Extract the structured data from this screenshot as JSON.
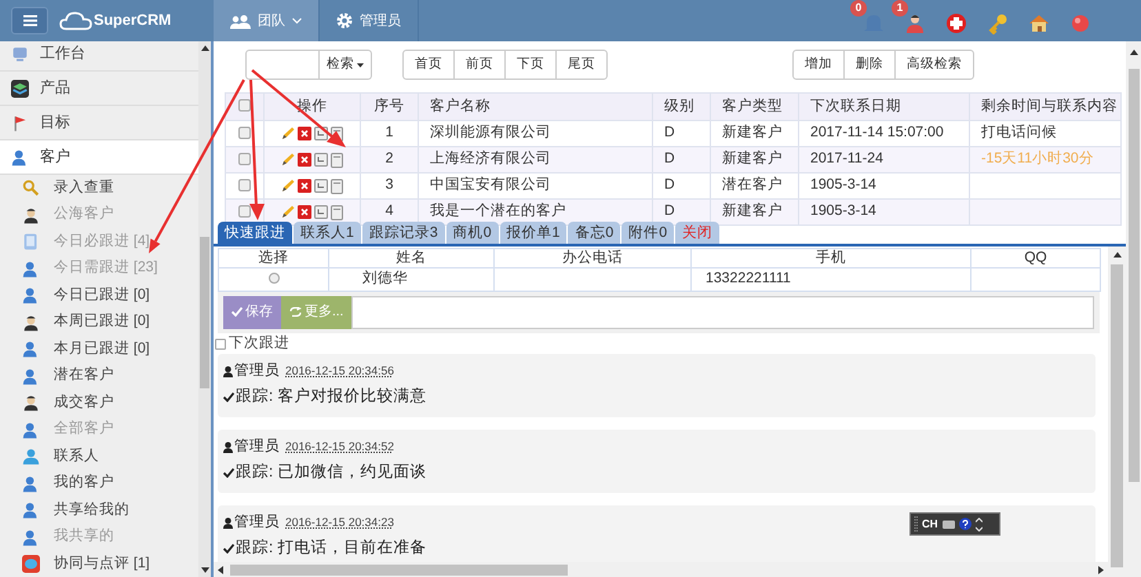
{
  "topbar": {
    "app_name": "SuperCRM",
    "nav": [
      {
        "label": "团队",
        "dropdown": true,
        "selected": true
      },
      {
        "label": "管理员",
        "dropdown": false,
        "selected": false
      }
    ],
    "icons": [
      {
        "kind": "bell",
        "badge": "0"
      },
      {
        "kind": "person",
        "badge": "1"
      },
      {
        "kind": "cross"
      },
      {
        "kind": "key"
      },
      {
        "kind": "house"
      },
      {
        "kind": "ball"
      }
    ]
  },
  "sidebar": {
    "items": [
      {
        "label": "工作台",
        "kind": "main",
        "selected": false
      },
      {
        "label": "产品",
        "kind": "main",
        "selected": false
      },
      {
        "label": "目标",
        "kind": "main",
        "selected": false
      },
      {
        "label": "客户",
        "kind": "main",
        "selected": true
      },
      {
        "label": "录入查重",
        "kind": "sub",
        "dimmed": false
      },
      {
        "label": "公海客户",
        "kind": "sub",
        "dimmed": true
      },
      {
        "label": "今日必跟进 [4]",
        "kind": "sub",
        "dimmed": true
      },
      {
        "label": "今日需跟进 [23]",
        "kind": "sub",
        "dimmed": true
      },
      {
        "label": "今日已跟进 [0]",
        "kind": "sub",
        "dimmed": false
      },
      {
        "label": "本周已跟进 [0]",
        "kind": "sub",
        "dimmed": false
      },
      {
        "label": "本月已跟进 [0]",
        "kind": "sub",
        "dimmed": false
      },
      {
        "label": "潜在客户",
        "kind": "sub",
        "dimmed": false
      },
      {
        "label": "成交客户",
        "kind": "sub",
        "dimmed": false
      },
      {
        "label": "全部客户",
        "kind": "sub",
        "dimmed": true
      },
      {
        "label": "联系人",
        "kind": "sub",
        "dimmed": false
      },
      {
        "label": "我的客户",
        "kind": "sub",
        "dimmed": false
      },
      {
        "label": "共享给我的",
        "kind": "sub",
        "dimmed": false
      },
      {
        "label": "我共享的",
        "kind": "sub",
        "dimmed": true
      },
      {
        "label": "协同与点评 [1]",
        "kind": "sub",
        "dimmed": false
      }
    ]
  },
  "toolbar": {
    "search_button": "检索",
    "pager": [
      "首页",
      "前页",
      "下页",
      "尾页"
    ],
    "actions": [
      "增加",
      "删除",
      "高级检索"
    ]
  },
  "table": {
    "all_selected": false,
    "columns": [
      "操作",
      "序号",
      "客户名称",
      "级别",
      "客户类型",
      "下次联系日期",
      "剩余时间与联系内容"
    ],
    "rows": [
      {
        "selected": false,
        "no": "1",
        "name": "深圳能源有限公司",
        "level": "D",
        "type": "新建客户",
        "next": "2017-11-14 15:07:00",
        "remaining": "打电话问候",
        "overdue": false
      },
      {
        "selected": false,
        "no": "2",
        "name": "上海经济有限公司",
        "level": "D",
        "type": "新建客户",
        "next": "2017-11-24",
        "remaining": "-15天11小时30分",
        "overdue": true
      },
      {
        "selected": false,
        "no": "3",
        "name": "中国宝安有限公司",
        "level": "D",
        "type": "潜在客户",
        "next": "1905-3-14"
      },
      {
        "selected": false,
        "no": "4",
        "name": "我是一个潜在的客户",
        "level": "D",
        "type": "新建客户",
        "next": "1905-3-14"
      }
    ]
  },
  "panel": {
    "tabs": [
      {
        "label": "快速跟进",
        "kind": "tab",
        "selected": true
      },
      {
        "label": "联系人1",
        "kind": "tab",
        "selected": false
      },
      {
        "label": "跟踪记录3",
        "kind": "tab",
        "selected": false
      },
      {
        "label": "商机0",
        "kind": "tab",
        "selected": false
      },
      {
        "label": "报价单1",
        "kind": "tab",
        "selected": false
      },
      {
        "label": "备忘0",
        "kind": "tab",
        "selected": false
      },
      {
        "label": "附件0",
        "kind": "tab",
        "selected": false
      },
      {
        "label": "关闭",
        "kind": "close",
        "selected": false
      }
    ],
    "contacts": {
      "columns": [
        "选择",
        "姓名",
        "办公电话",
        "手机",
        "QQ"
      ],
      "rows": [
        {
          "selected": false,
          "name": "刘德华",
          "mobile": "13322221111"
        }
      ]
    },
    "buttons": [
      {
        "label": "保存",
        "kind": "save"
      },
      {
        "label": "更多...",
        "kind": "more"
      }
    ],
    "next_followup": {
      "label": "下次跟进",
      "checked": false
    },
    "records": [
      {
        "author": "管理员",
        "time": "2016-12-15 20:34:56",
        "text": "跟踪: 客户对报价比较满意"
      },
      {
        "author": "管理员",
        "time": "2016-12-15 20:34:52",
        "text": "跟踪: 已加微信，约见面谈"
      },
      {
        "author": "管理员",
        "time": "2016-12-15 20:34:23",
        "text": "跟踪: 打电话，目前在准备"
      }
    ]
  },
  "ime": {
    "label": "CH"
  }
}
